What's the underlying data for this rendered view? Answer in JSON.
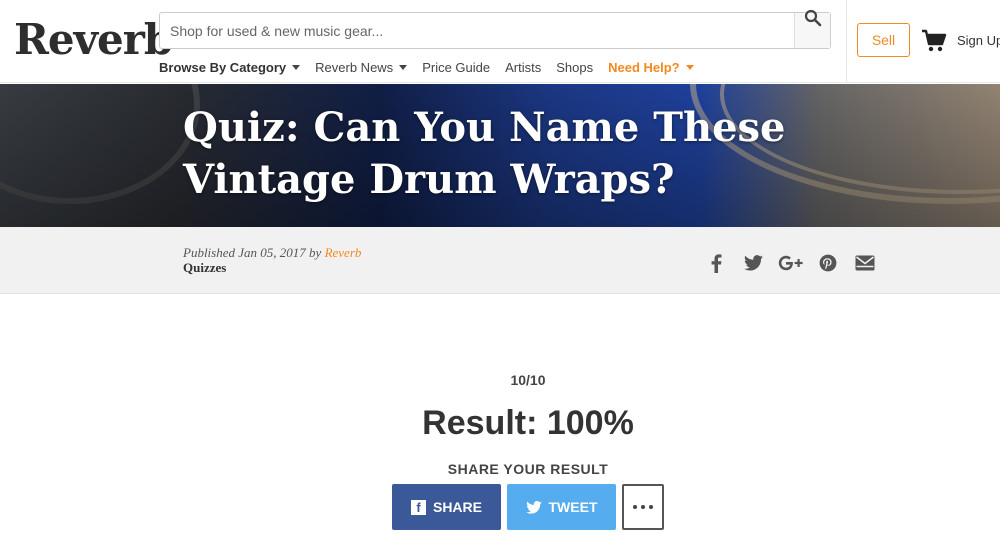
{
  "header": {
    "logo": "Reverb",
    "search": {
      "placeholder": "Shop for used & new music gear..."
    },
    "nav": [
      {
        "label": "Browse By Category",
        "dropdown": true
      },
      {
        "label": "Reverb News",
        "dropdown": true
      },
      {
        "label": "Price Guide"
      },
      {
        "label": "Artists"
      },
      {
        "label": "Shops"
      },
      {
        "label": "Need Help?",
        "dropdown": true
      }
    ],
    "sell_label": "Sell",
    "signup_label": "Sign Up"
  },
  "hero": {
    "title": "Quiz: Can You Name These Vintage Drum Wraps?"
  },
  "meta": {
    "published_prefix": "Published",
    "date": "Jan 05, 2017",
    "by": "by",
    "author": "Reverb",
    "category": "Quizzes",
    "social_icons": [
      "facebook-icon",
      "twitter-icon",
      "google-plus-icon",
      "pinterest-icon",
      "email-icon"
    ]
  },
  "result": {
    "score": "10/10",
    "text": "Result: 100%",
    "share_label": "SHARE YOUR RESULT",
    "share_button": "SHARE",
    "tweet_button": "TWEET"
  },
  "colors": {
    "accent": "#f28a1f",
    "facebook": "#3b5998",
    "twitter": "#55acee"
  }
}
